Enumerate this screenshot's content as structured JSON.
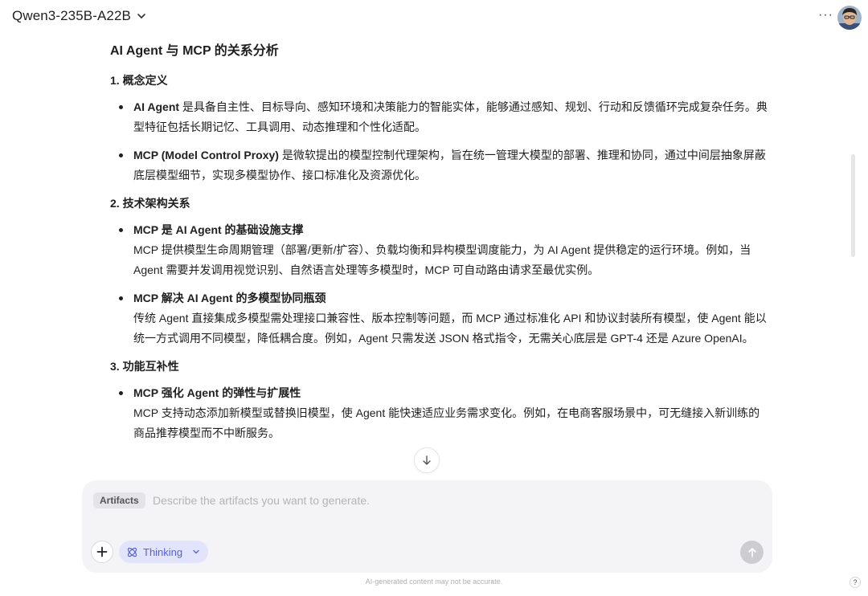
{
  "header": {
    "model_name": "Qwen3-235B-A22B",
    "more_label": "···"
  },
  "article": {
    "title": "AI Agent 与 MCP 的关系分析",
    "sections": [
      {
        "heading": "1. 概念定义",
        "items": [
          {
            "bold": "AI Agent",
            "text": " 是具备自主性、目标导向、感知环境和决策能力的智能实体，能够通过感知、规划、行动和反馈循环完成复杂任务。典型特征包括长期记忆、工具调用、动态推理和个性化适配。"
          },
          {
            "bold": "MCP (Model Control Proxy)",
            "text": " 是微软提出的模型控制代理架构，旨在统一管理大模型的部署、推理和协同，通过中间层抽象屏蔽底层模型细节，实现多模型协作、接口标准化及资源优化。"
          }
        ]
      },
      {
        "heading": "2. 技术架构关系",
        "items": [
          {
            "bold": "MCP 是 AI Agent 的基础设施支撑",
            "text": "MCP 提供模型生命周期管理（部署/更新/扩容）、负载均衡和异构模型调度能力，为 AI Agent 提供稳定的运行环境。例如，当 Agent 需要并发调用视觉识别、自然语言处理等多模型时，MCP 可自动路由请求至最优实例。"
          },
          {
            "bold": "MCP 解决 AI Agent 的多模型协同瓶颈",
            "text": "传统 Agent 直接集成多模型需处理接口兼容性、版本控制等问题，而 MCP 通过标准化 API 和协议封装所有模型，使 Agent 能以统一方式调用不同模型，降低耦合度。例如，Agent 只需发送 JSON 格式指令，无需关心底层是 GPT-4 还是 Azure OpenAI。"
          }
        ]
      },
      {
        "heading": "3. 功能互补性",
        "items": [
          {
            "bold": "MCP 强化 Agent 的弹性与扩展性",
            "text": "MCP 支持动态添加新模型或替换旧模型，使 Agent 能快速适应业务需求变化。例如，在电商客服场景中，可无缝接入新训练的商品推荐模型而不中断服务。"
          }
        ]
      }
    ]
  },
  "composer": {
    "tag_label": "Artifacts",
    "placeholder": "Describe the artifacts you want to generate.",
    "thinking_label": "Thinking"
  },
  "footer": {
    "disclaimer": "AI-generated content may not be accurate.",
    "help_label": "?"
  }
}
